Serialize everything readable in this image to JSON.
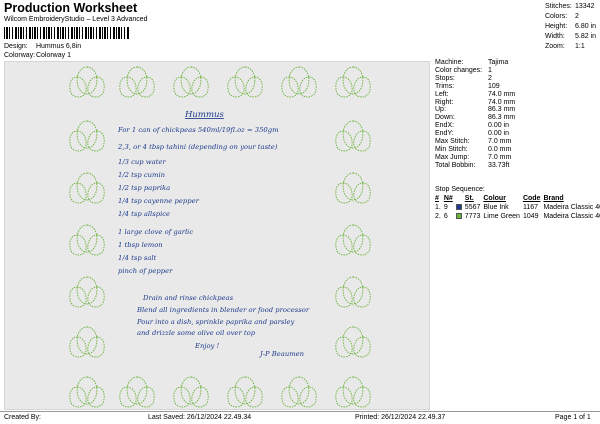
{
  "header": {
    "title": "Production Worksheet",
    "subtitle": "Wilcom EmbroideryStudio – Level 3 Advanced",
    "design_label": "Design:",
    "design_value": "Hummus 6,8in",
    "colorway_label": "Colorway:",
    "colorway_value": "Colorway 1"
  },
  "top_stats": [
    {
      "label": "Stitches:",
      "value": "13342"
    },
    {
      "label": "Colors:",
      "value": "2"
    },
    {
      "label": "Height:",
      "value": "6.80 in"
    },
    {
      "label": "Width:",
      "value": "5.82 in"
    },
    {
      "label": "Zoom:",
      "value": "1:1"
    }
  ],
  "specs": [
    {
      "label": "Machine:",
      "value": "Tajima"
    },
    {
      "label": "Color changes:",
      "value": "1"
    },
    {
      "label": "Stops:",
      "value": "2"
    },
    {
      "label": "Trims:",
      "value": "109"
    },
    {
      "label": "Left:",
      "value": "74.0 mm"
    },
    {
      "label": "Right:",
      "value": "74.0 mm"
    },
    {
      "label": "Up:",
      "value": "86.3 mm"
    },
    {
      "label": "Down:",
      "value": "86.3 mm"
    },
    {
      "label": "EndX:",
      "value": "0.00 in"
    },
    {
      "label": "EndY:",
      "value": "0.00 in"
    },
    {
      "label": "Max Stitch:",
      "value": "7.0 mm"
    },
    {
      "label": "Min Stitch:",
      "value": "0.0 mm"
    },
    {
      "label": "Max Jump:",
      "value": "7.0 mm"
    },
    {
      "label": "Total Bobbin:",
      "value": "33.73ft"
    }
  ],
  "stop_sequence": {
    "title": "Stop Sequence:",
    "headers": [
      "#",
      "N#",
      "",
      "St.",
      "Colour",
      "Code",
      "Brand"
    ],
    "rows": [
      {
        "num": "1.",
        "needle": "9",
        "color": "#1b3a8c",
        "stitches": "5567",
        "name": "Blue Ink",
        "code": "1167",
        "brand": "Madeira Classic 40"
      },
      {
        "num": "2.",
        "needle": "6",
        "color": "#6db33f",
        "stitches": "7773",
        "name": "Lime Green",
        "code": "1049",
        "brand": "Madeira Classic 40"
      }
    ]
  },
  "recipe": {
    "title": "Hummus",
    "lines": [
      "For 1 can of chickpeas 540ml/19fl.oz = 350gm",
      "2,3, or 4 tbsp tahini (depending on your taste)",
      "1/3 cup water",
      "1/2 tsp cumin",
      "1/2 tsp paprika",
      "1/4 tsp cayenne pepper",
      "1/4 tsp allspice",
      "1 large clove of garlic",
      "1 tbsp lemon",
      "1/4 tsp salt",
      "pinch of pepper"
    ],
    "directions": [
      "Drain and rinse chickpeas",
      "Blend all ingredients in blender or food processor",
      "Pour into a dish, sprinkle paprika and parsley",
      "and drizzle some olive oil over top",
      "Enjoy !"
    ],
    "signature": "J-P Beaumen"
  },
  "footer": {
    "created_by": "Created By:",
    "last_saved": "Last Saved: 26/12/2024 22.49.34",
    "printed": "Printed: 26/12/2024 22.49.37",
    "page": "Page 1 of 1"
  }
}
